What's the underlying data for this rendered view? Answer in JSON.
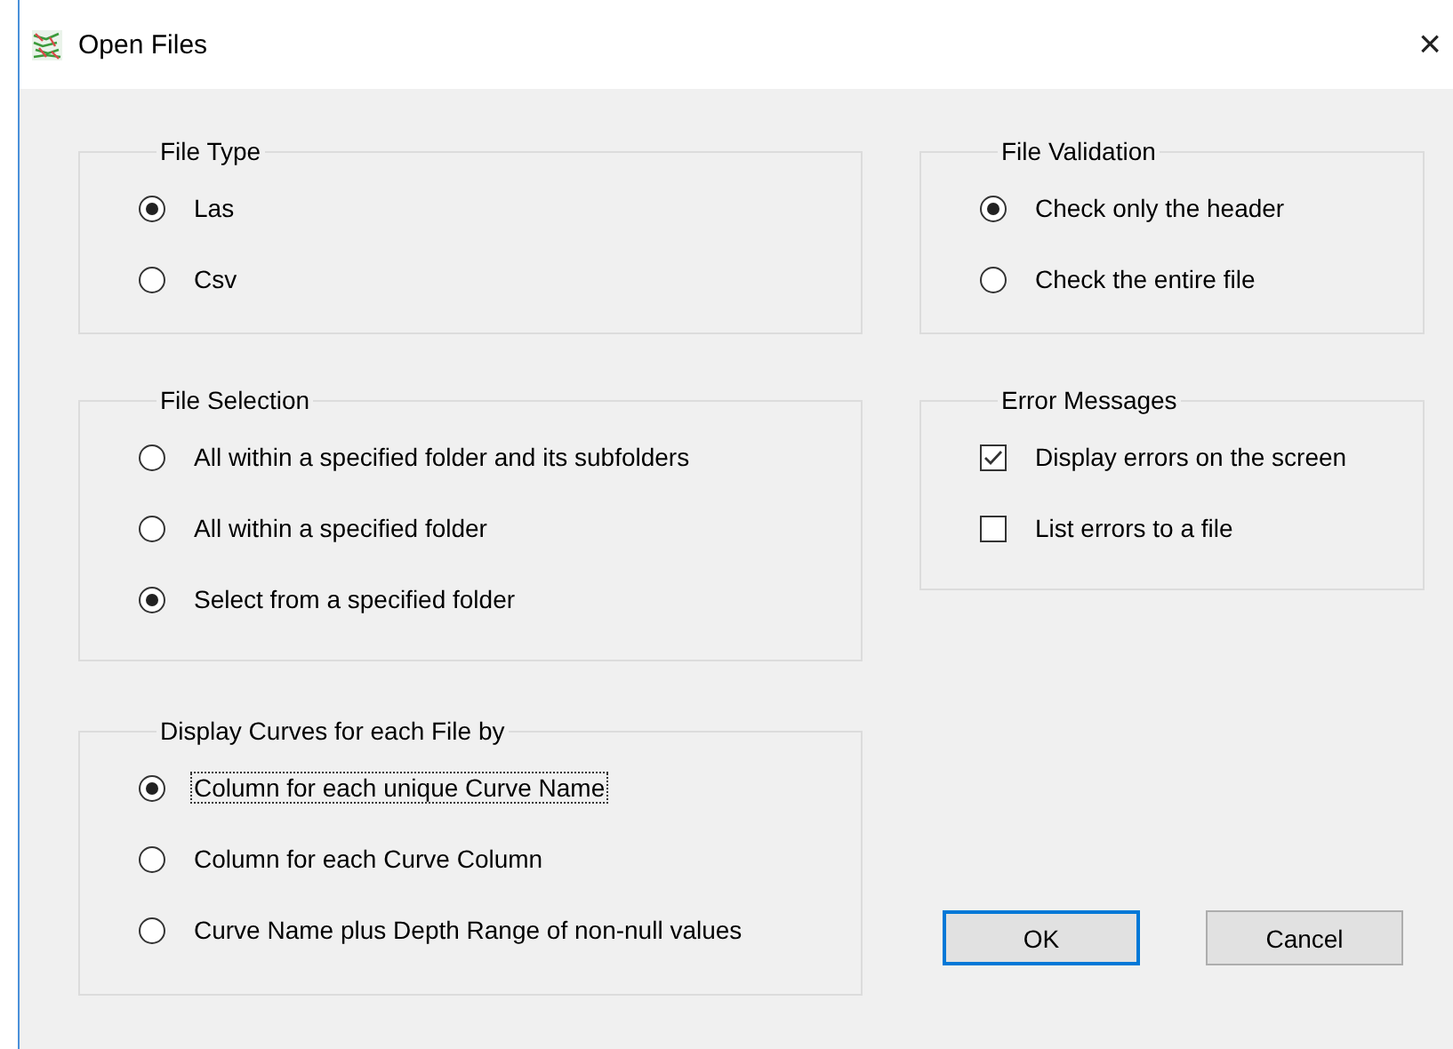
{
  "window": {
    "title": "Open Files",
    "close": "×"
  },
  "file_type": {
    "title": "File Type",
    "options": [
      {
        "label": "Las",
        "selected": true,
        "focused": false
      },
      {
        "label": "Csv",
        "selected": false,
        "focused": false
      }
    ]
  },
  "file_selection": {
    "title": "File Selection",
    "options": [
      {
        "label": "All within a specified folder and its subfolders",
        "selected": false,
        "focused": false
      },
      {
        "label": "All within a specified folder",
        "selected": false,
        "focused": false
      },
      {
        "label": "Select from a specified folder",
        "selected": true,
        "focused": false
      }
    ]
  },
  "display_curves": {
    "title": "Display Curves for each File by",
    "options": [
      {
        "label": "Column for each unique Curve Name",
        "selected": true,
        "focused": true
      },
      {
        "label": "Column for each Curve Column",
        "selected": false,
        "focused": false
      },
      {
        "label": "Curve Name plus Depth Range of non-null values",
        "selected": false,
        "focused": false
      }
    ]
  },
  "file_validation": {
    "title": "File Validation",
    "options": [
      {
        "label": "Check only the header",
        "selected": true,
        "focused": false
      },
      {
        "label": "Check the entire file",
        "selected": false,
        "focused": false
      }
    ]
  },
  "error_messages": {
    "title": "Error Messages",
    "checkboxes": [
      {
        "label": "Display errors on the screen",
        "checked": true
      },
      {
        "label": "List errors to a file",
        "checked": false
      }
    ]
  },
  "buttons": [
    {
      "label": "OK",
      "default": true
    },
    {
      "label": "Cancel",
      "default": false
    }
  ]
}
